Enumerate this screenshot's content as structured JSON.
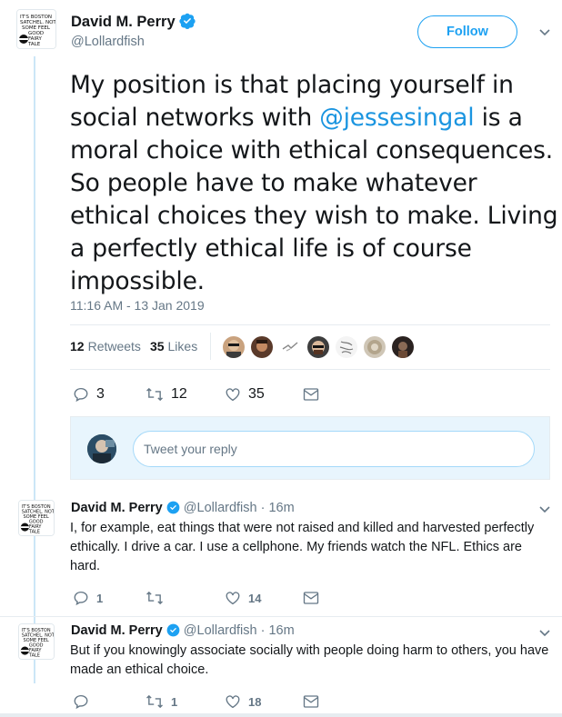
{
  "main_tweet": {
    "author_name": "David M. Perry",
    "handle": "@Lollardfish",
    "follow_label": "Follow",
    "text_parts": {
      "before": "My position is that placing yourself in social networks with ",
      "mention": "@jessesingal",
      "after": " is a moral choice with ethical consequences. So people have to make whatever ethical choices they wish to make. Living a perfectly ethical life is of course impossible."
    },
    "timestamp": "11:16 AM - 13 Jan 2019",
    "retweets_count": "12",
    "retweets_label": "Retweets",
    "likes_count": "35",
    "likes_label": "Likes",
    "actions": {
      "replies": "3",
      "retweets": "12",
      "likes": "35"
    }
  },
  "reply_box": {
    "placeholder": "Tweet your reply"
  },
  "replies": [
    {
      "author_name": "David M. Perry",
      "handle": "@Lollardfish",
      "time": "16m",
      "text": "I, for example, eat things that were not raised and killed and harvested perfectly ethically. I drive a car. I use a cellphone. My friends watch the NFL. Ethics are hard.",
      "actions": {
        "replies": "1",
        "retweets": "",
        "likes": "14"
      }
    },
    {
      "author_name": "David M. Perry",
      "handle": "@Lollardfish",
      "time": "16m",
      "text": "But if you knowingly associate socially with people doing harm to others, you have made an ethical choice.",
      "actions": {
        "replies": "",
        "retweets": "1",
        "likes": "18"
      }
    }
  ],
  "colors": {
    "accent": "#1da1f2",
    "mention": "#1b95e0",
    "muted": "#657786",
    "thread_line": "#cce6f7"
  },
  "icons": [
    "avatar-doodle",
    "verified-badge-icon",
    "chevron-down-icon",
    "reply-icon",
    "retweet-icon",
    "like-icon",
    "message-icon"
  ]
}
